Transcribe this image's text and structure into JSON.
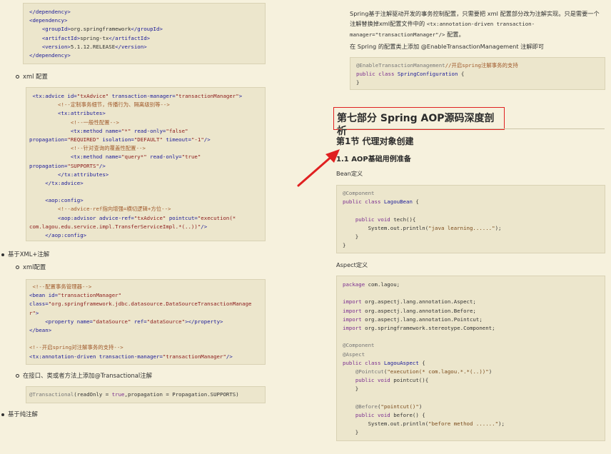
{
  "left": {
    "code_dependency": [
      [
        {
          "c": "tag",
          "t": "</dependency>"
        }
      ],
      [
        {
          "c": "tag",
          "t": "<dependency>"
        }
      ],
      [
        {
          "c": "plain",
          "t": "    "
        },
        {
          "c": "tag",
          "t": "<groupId>"
        },
        {
          "c": "plain",
          "t": "org.springframework"
        },
        {
          "c": "tag",
          "t": "</groupId>"
        }
      ],
      [
        {
          "c": "plain",
          "t": "    "
        },
        {
          "c": "tag",
          "t": "<artifactId>"
        },
        {
          "c": "plain",
          "t": "spring-tx"
        },
        {
          "c": "tag",
          "t": "</artifactId>"
        }
      ],
      [
        {
          "c": "plain",
          "t": "    "
        },
        {
          "c": "tag",
          "t": "<version>"
        },
        {
          "c": "plain",
          "t": "5.1.12.RELEASE"
        },
        {
          "c": "tag",
          "t": "</version>"
        }
      ],
      [
        {
          "c": "tag",
          "t": "</dependency>"
        }
      ]
    ],
    "bullet_xml_config_1": "xml 配置",
    "code_advice": [
      [
        {
          "c": "plain",
          "t": " "
        },
        {
          "c": "tag",
          "t": "<tx:advice"
        },
        {
          "c": "plain",
          "t": " "
        },
        {
          "c": "attr",
          "t": "id="
        },
        {
          "c": "str",
          "t": "\"txAdvice\""
        },
        {
          "c": "plain",
          "t": " "
        },
        {
          "c": "attr",
          "t": "transaction-manager="
        },
        {
          "c": "str",
          "t": "\"transactionManager\""
        },
        {
          "c": "tag",
          "t": ">"
        }
      ],
      [
        {
          "c": "plain",
          "t": "         "
        },
        {
          "c": "cmt",
          "t": "<!--定制事务细节，传播行为、隔离级别等-->"
        }
      ],
      [
        {
          "c": "plain",
          "t": "         "
        },
        {
          "c": "tag",
          "t": "<tx:attributes>"
        }
      ],
      [
        {
          "c": "plain",
          "t": "             "
        },
        {
          "c": "cmt",
          "t": "<!--一般性配置-->"
        }
      ],
      [
        {
          "c": "plain",
          "t": "             "
        },
        {
          "c": "tag",
          "t": "<tx:method"
        },
        {
          "c": "plain",
          "t": " "
        },
        {
          "c": "attr",
          "t": "name="
        },
        {
          "c": "str",
          "t": "\"*\""
        },
        {
          "c": "plain",
          "t": " "
        },
        {
          "c": "attr",
          "t": "read-only="
        },
        {
          "c": "str",
          "t": "\"false\""
        }
      ],
      [
        {
          "c": "attr",
          "t": "propagation="
        },
        {
          "c": "str",
          "t": "\"REQUIRED\""
        },
        {
          "c": "plain",
          "t": " "
        },
        {
          "c": "attr",
          "t": "isolation="
        },
        {
          "c": "str",
          "t": "\"DEFAULT\""
        },
        {
          "c": "plain",
          "t": " "
        },
        {
          "c": "attr",
          "t": "timeout="
        },
        {
          "c": "str",
          "t": "\"-1\""
        },
        {
          "c": "tag",
          "t": "/>"
        }
      ],
      [
        {
          "c": "plain",
          "t": "             "
        },
        {
          "c": "cmt",
          "t": "<!--针对查询的覆盖性配置-->"
        }
      ],
      [
        {
          "c": "plain",
          "t": "             "
        },
        {
          "c": "tag",
          "t": "<tx:method"
        },
        {
          "c": "plain",
          "t": " "
        },
        {
          "c": "attr",
          "t": "name="
        },
        {
          "c": "str",
          "t": "\"query*\""
        },
        {
          "c": "plain",
          "t": " "
        },
        {
          "c": "attr",
          "t": "read-only="
        },
        {
          "c": "str",
          "t": "\"true\""
        }
      ],
      [
        {
          "c": "attr",
          "t": "propagation="
        },
        {
          "c": "str",
          "t": "\"SUPPORTS\""
        },
        {
          "c": "tag",
          "t": "/>"
        }
      ],
      [
        {
          "c": "plain",
          "t": "         "
        },
        {
          "c": "tag",
          "t": "</tx:attributes>"
        }
      ],
      [
        {
          "c": "plain",
          "t": "     "
        },
        {
          "c": "tag",
          "t": "</tx:advice>"
        }
      ],
      [
        {
          "c": "plain",
          "t": " "
        }
      ],
      [
        {
          "c": "plain",
          "t": "     "
        },
        {
          "c": "tag",
          "t": "<aop:config>"
        }
      ],
      [
        {
          "c": "plain",
          "t": "         "
        },
        {
          "c": "cmt",
          "t": "<!--advice-ref指向增强=横切逻辑+方位-->"
        }
      ],
      [
        {
          "c": "plain",
          "t": "         "
        },
        {
          "c": "tag",
          "t": "<aop:advisor"
        },
        {
          "c": "plain",
          "t": " "
        },
        {
          "c": "attr",
          "t": "advice-ref="
        },
        {
          "c": "str",
          "t": "\"txAdvice\""
        },
        {
          "c": "plain",
          "t": " "
        },
        {
          "c": "attr",
          "t": "pointcut="
        },
        {
          "c": "str",
          "t": "\"execution(*"
        }
      ],
      [
        {
          "c": "str",
          "t": "com.lagou.edu.service.impl.TransferServiceImpl.*(..))\""
        },
        {
          "c": "tag",
          "t": "/>"
        }
      ],
      [
        {
          "c": "plain",
          "t": "     "
        },
        {
          "c": "tag",
          "t": "</aop:config>"
        }
      ]
    ],
    "bullet_xml_annotation": "基于XML+注解",
    "bullet_xml_config_2": "xml配置",
    "code_tm": [
      [
        {
          "c": "plain",
          "t": " "
        },
        {
          "c": "cmt",
          "t": "<!--配置事务管理器-->"
        }
      ],
      [
        {
          "c": "tag",
          "t": "<bean"
        },
        {
          "c": "plain",
          "t": " "
        },
        {
          "c": "attr",
          "t": "id="
        },
        {
          "c": "str",
          "t": "\"transactionManager\""
        }
      ],
      [
        {
          "c": "attr",
          "t": "class="
        },
        {
          "c": "str",
          "t": "\"org.springframework.jdbc.datasource.DataSourceTransactionManage"
        }
      ],
      [
        {
          "c": "str",
          "t": "r\""
        },
        {
          "c": "tag",
          "t": ">"
        }
      ],
      [
        {
          "c": "plain",
          "t": "     "
        },
        {
          "c": "tag",
          "t": "<property"
        },
        {
          "c": "plain",
          "t": " "
        },
        {
          "c": "attr",
          "t": "name="
        },
        {
          "c": "str",
          "t": "\"dataSource\""
        },
        {
          "c": "plain",
          "t": " "
        },
        {
          "c": "attr",
          "t": "ref="
        },
        {
          "c": "str",
          "t": "\"dataSource\""
        },
        {
          "c": "tag",
          "t": "></property>"
        }
      ],
      [
        {
          "c": "tag",
          "t": "</bean>"
        }
      ],
      [
        {
          "c": "plain",
          "t": " "
        }
      ],
      [
        {
          "c": "cmt",
          "t": "<!--开启spring对注解事务的支持-->"
        }
      ],
      [
        {
          "c": "tag",
          "t": "<tx:annotation-driven"
        },
        {
          "c": "plain",
          "t": " "
        },
        {
          "c": "attr",
          "t": "transaction-manager="
        },
        {
          "c": "str",
          "t": "\"transactionManager\""
        },
        {
          "c": "tag",
          "t": "/>"
        }
      ]
    ],
    "bullet_transactional": "在接口、类或者方法上添加@Transactional注解",
    "code_transactional": [
      [
        {
          "c": "anno",
          "t": "@Transactional"
        },
        {
          "c": "plain",
          "t": "(readOnly = "
        },
        {
          "c": "kw",
          "t": "true"
        },
        {
          "c": "plain",
          "t": ",propagation = Propagation.SUPPORTS)"
        }
      ]
    ],
    "bullet_pure_annotation": "基于纯注解"
  },
  "right": {
    "para1_a": "Spring基于注解驱动开发的事务控制配置，只需要把 xml 配置部分改为注解实现。只是需要一个",
    "para1_b": "注解替换掉xml配置文件中的 ",
    "para1_mono": "<tx:annotation-driven transaction-",
    "para1_c_mono": "manager=\"transactionManager\"/>",
    "para1_c": " 配置。",
    "para2": "在 Spring 的配置类上添加 @EnableTransactionManagement 注解即可",
    "code_enable": [
      [
        {
          "c": "anno",
          "t": "@EnableTransactionManagement"
        },
        {
          "c": "cmt",
          "t": "//开启spring注解事务的支持"
        }
      ],
      [
        {
          "c": "kw",
          "t": "public class"
        },
        {
          "c": "plain",
          "t": " "
        },
        {
          "c": "tag",
          "t": "SpringConfiguration"
        },
        {
          "c": "plain",
          "t": " {"
        }
      ],
      [
        {
          "c": "plain",
          "t": "}"
        }
      ]
    ],
    "heading1": "第七部分 Spring AOP源码深度剖析",
    "heading2": "第1节 代理对象创建",
    "heading3": "1.1 AOP基础用例准备",
    "bean_def_label": "Bean定义",
    "code_bean": [
      [
        {
          "c": "anno",
          "t": "@Component"
        }
      ],
      [
        {
          "c": "kw",
          "t": "public class"
        },
        {
          "c": "plain",
          "t": " "
        },
        {
          "c": "tag",
          "t": "LagouBean"
        },
        {
          "c": "plain",
          "t": " {"
        }
      ],
      [
        {
          "c": "plain",
          "t": " "
        }
      ],
      [
        {
          "c": "plain",
          "t": "    "
        },
        {
          "c": "kw",
          "t": "public void"
        },
        {
          "c": "plain",
          "t": " tech(){"
        }
      ],
      [
        {
          "c": "plain",
          "t": "        System.out.println("
        },
        {
          "c": "jstr",
          "t": "\"java learning......\""
        },
        {
          "c": "plain",
          "t": ");"
        }
      ],
      [
        {
          "c": "plain",
          "t": "    }"
        }
      ],
      [
        {
          "c": "plain",
          "t": "}"
        }
      ]
    ],
    "aspect_def_label": "Aspect定义",
    "code_aspect": [
      [
        {
          "c": "kw",
          "t": "package"
        },
        {
          "c": "plain",
          "t": " com.lagou;"
        }
      ],
      [
        {
          "c": "plain",
          "t": " "
        }
      ],
      [
        {
          "c": "kw",
          "t": "import"
        },
        {
          "c": "plain",
          "t": " org.aspectj.lang.annotation.Aspect;"
        }
      ],
      [
        {
          "c": "kw",
          "t": "import"
        },
        {
          "c": "plain",
          "t": " org.aspectj.lang.annotation.Before;"
        }
      ],
      [
        {
          "c": "kw",
          "t": "import"
        },
        {
          "c": "plain",
          "t": " org.aspectj.lang.annotation.Pointcut;"
        }
      ],
      [
        {
          "c": "kw",
          "t": "import"
        },
        {
          "c": "plain",
          "t": " org.springframework.stereotype.Component;"
        }
      ],
      [
        {
          "c": "plain",
          "t": " "
        }
      ],
      [
        {
          "c": "anno",
          "t": "@Component"
        }
      ],
      [
        {
          "c": "anno",
          "t": "@Aspect"
        }
      ],
      [
        {
          "c": "kw",
          "t": "public class"
        },
        {
          "c": "plain",
          "t": " "
        },
        {
          "c": "tag",
          "t": "LagouAspect"
        },
        {
          "c": "plain",
          "t": " {"
        }
      ],
      [
        {
          "c": "plain",
          "t": "    "
        },
        {
          "c": "anno",
          "t": "@Pointcut"
        },
        {
          "c": "plain",
          "t": "("
        },
        {
          "c": "jstr",
          "t": "\"execution(* com.lagou.*.*(..))\""
        },
        {
          "c": "plain",
          "t": ")"
        }
      ],
      [
        {
          "c": "plain",
          "t": "    "
        },
        {
          "c": "kw",
          "t": "public void"
        },
        {
          "c": "plain",
          "t": " pointcut(){"
        }
      ],
      [
        {
          "c": "plain",
          "t": "    }"
        }
      ],
      [
        {
          "c": "plain",
          "t": " "
        }
      ],
      [
        {
          "c": "plain",
          "t": "    "
        },
        {
          "c": "anno",
          "t": "@Before"
        },
        {
          "c": "plain",
          "t": "("
        },
        {
          "c": "jstr",
          "t": "\"pointcut()\""
        },
        {
          "c": "plain",
          "t": ")"
        }
      ],
      [
        {
          "c": "plain",
          "t": "    "
        },
        {
          "c": "kw",
          "t": "public void"
        },
        {
          "c": "plain",
          "t": " before() {"
        }
      ],
      [
        {
          "c": "plain",
          "t": "        System.out.println("
        },
        {
          "c": "jstr",
          "t": "\"before method ......\""
        },
        {
          "c": "plain",
          "t": ");"
        }
      ],
      [
        {
          "c": "plain",
          "t": "    }"
        }
      ]
    ]
  },
  "colors": {
    "background": "#f6f1dd",
    "code_background": "#ece6cc",
    "callout_red": "#e02020"
  },
  "icons": {
    "callout": "arrow-icon"
  }
}
